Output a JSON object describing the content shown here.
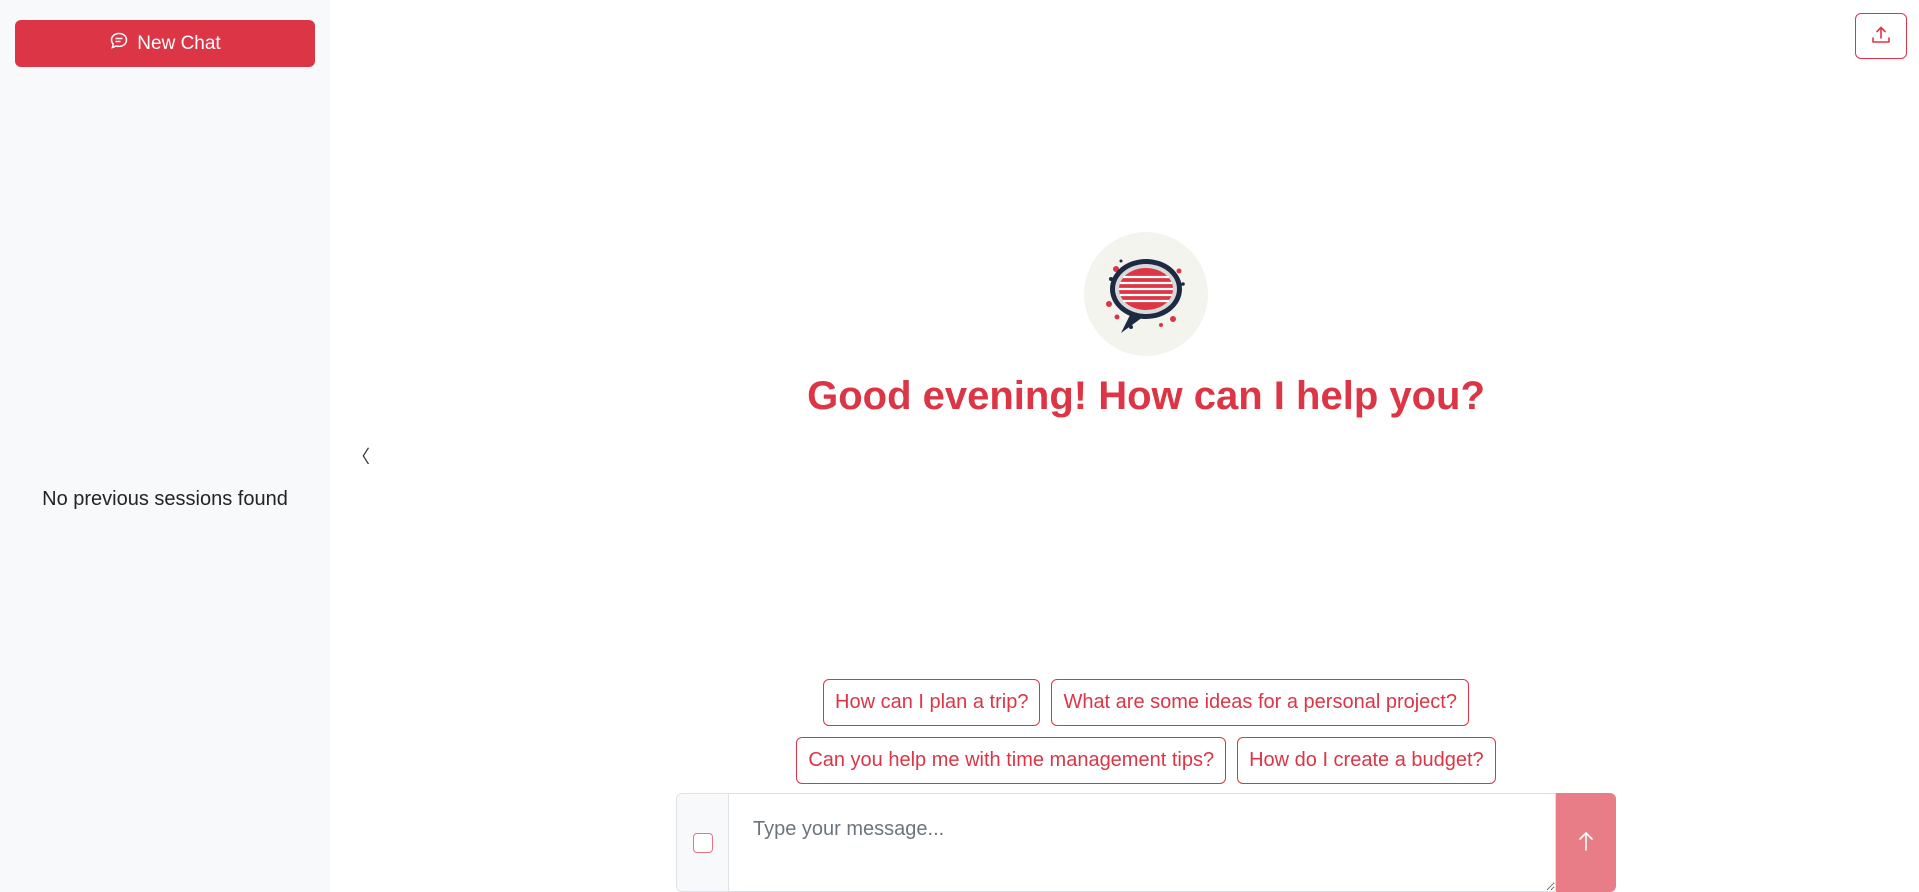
{
  "sidebar": {
    "new_chat_label": "New Chat",
    "empty_state": "No previous sessions found"
  },
  "collapse_toggle": "〈",
  "main": {
    "greeting": "Good evening! How can I help you?",
    "suggestions": [
      "How can I plan a trip?",
      "What are some ideas for a personal project?",
      "Can you help me with time management tips?",
      "How do I create a budget?"
    ]
  },
  "input": {
    "placeholder": "Type your message...",
    "value": ""
  },
  "icons": {
    "new_chat": "chat-bubble-icon",
    "export": "upload-icon",
    "send": "arrow-up-icon",
    "logo": "speech-bubble-logo"
  },
  "colors": {
    "accent": "#dc3545",
    "send_disabled": "#e87d88",
    "sidebar_bg": "#f8f9fa"
  }
}
